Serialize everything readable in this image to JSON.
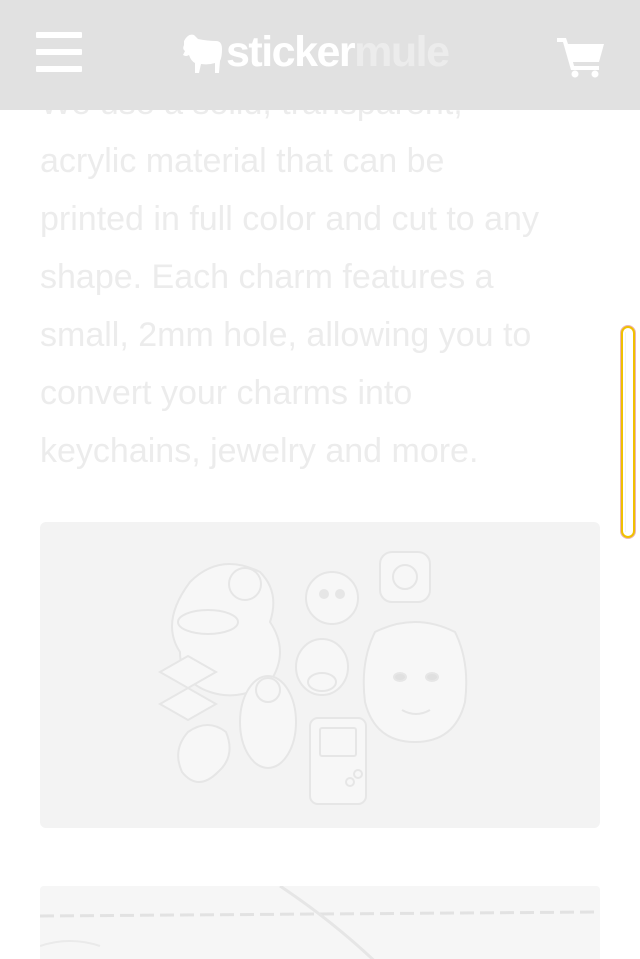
{
  "header": {
    "menu_icon": "hamburger-menu-icon",
    "logo": {
      "part1": "sticker",
      "part2": "mule",
      "icon": "mule-logo-icon"
    },
    "cart_icon": "shopping-cart-icon",
    "background": "#e0e0e0"
  },
  "content": {
    "first_line": "We use a solid, transparent,",
    "lines": [
      "acrylic material that can be",
      "printed in full color and cut to any",
      "shape. Each charm features a",
      "small, 2mm hole, allowing you to",
      "convert your charms into",
      "keychains, jewelry and more."
    ],
    "text_color": "#ececec"
  },
  "images": {
    "product_image": "acrylic-charms-illustration",
    "secondary_image": "product-photo"
  },
  "scrollbar": {
    "border_color": "#f0c000"
  }
}
